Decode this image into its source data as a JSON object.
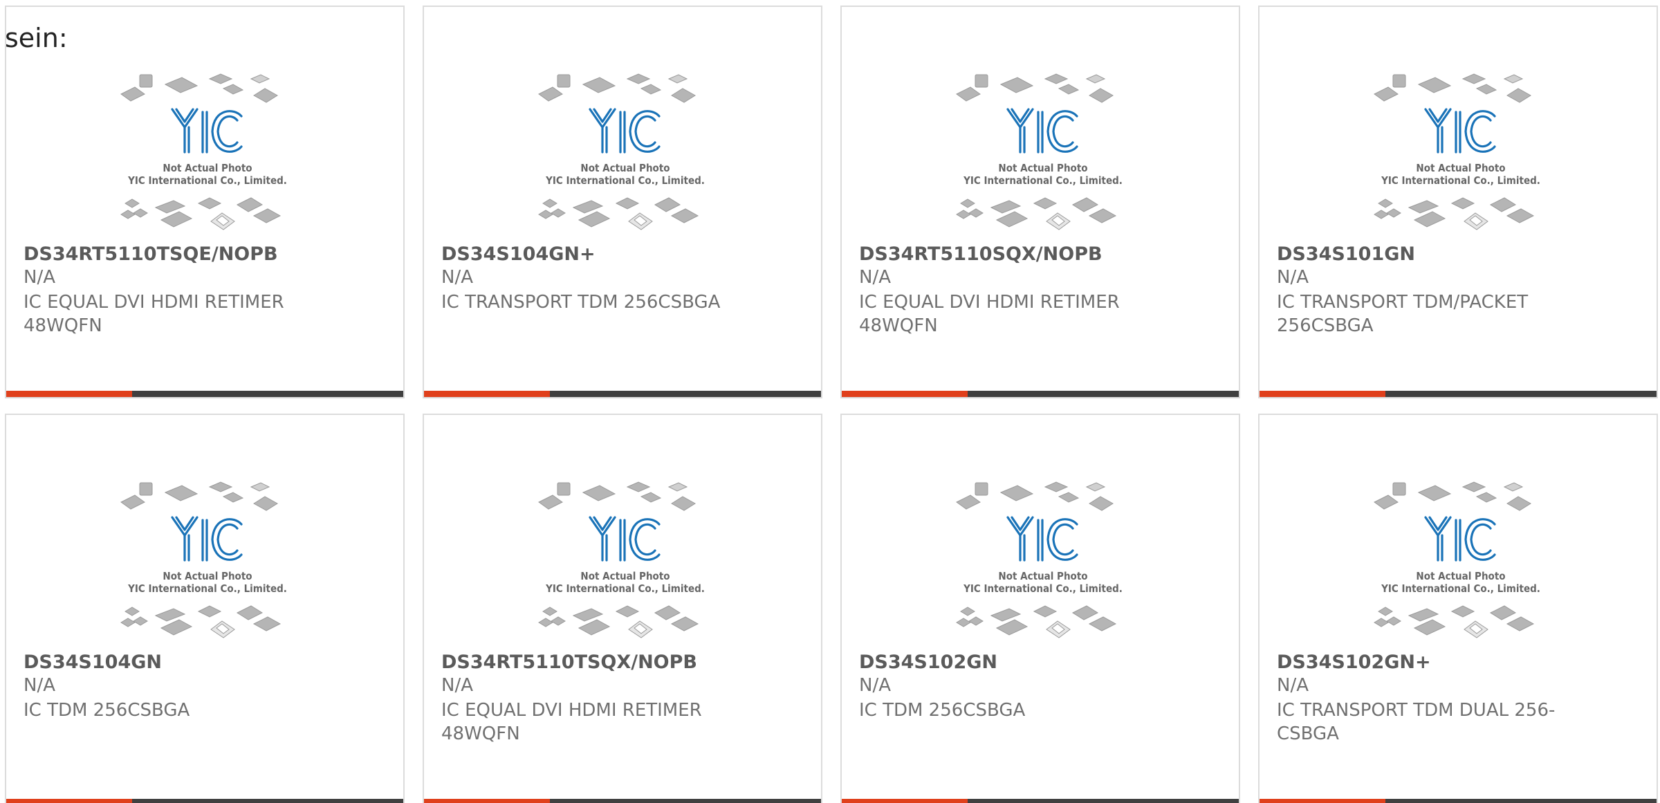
{
  "intro_text": "sein:",
  "colors": {
    "accent": "#e0401c",
    "bar_dark": "#404040",
    "logo_blue": "#1a73b8"
  },
  "photo": {
    "logo_text": "YIC",
    "caption_line1": "Not Actual Photo",
    "caption_line2": "YIC International Co., Limited."
  },
  "products": [
    {
      "part_number": "DS34RT5110TSQE/NOPB",
      "manufacturer": "N/A",
      "description": "IC EQUAL DVI HDMI RETIMER 48WQFN"
    },
    {
      "part_number": "DS34S104GN+",
      "manufacturer": "N/A",
      "description": "IC TRANSPORT TDM 256CSBGA"
    },
    {
      "part_number": "DS34RT5110SQX/NOPB",
      "manufacturer": "N/A",
      "description": "IC EQUAL DVI HDMI RETIMER 48WQFN"
    },
    {
      "part_number": "DS34S101GN",
      "manufacturer": "N/A",
      "description": "IC TRANSPORT TDM/PACKET 256CSBGA"
    },
    {
      "part_number": "DS34S104GN",
      "manufacturer": "N/A",
      "description": "IC TDM 256CSBGA"
    },
    {
      "part_number": "DS34RT5110TSQX/NOPB",
      "manufacturer": "N/A",
      "description": "IC EQUAL DVI HDMI RETIMER 48WQFN"
    },
    {
      "part_number": "DS34S102GN",
      "manufacturer": "N/A",
      "description": "IC TDM 256CSBGA"
    },
    {
      "part_number": "DS34S102GN+",
      "manufacturer": "N/A",
      "description": "IC TRANSPORT TDM DUAL 256-CSBGA"
    }
  ]
}
